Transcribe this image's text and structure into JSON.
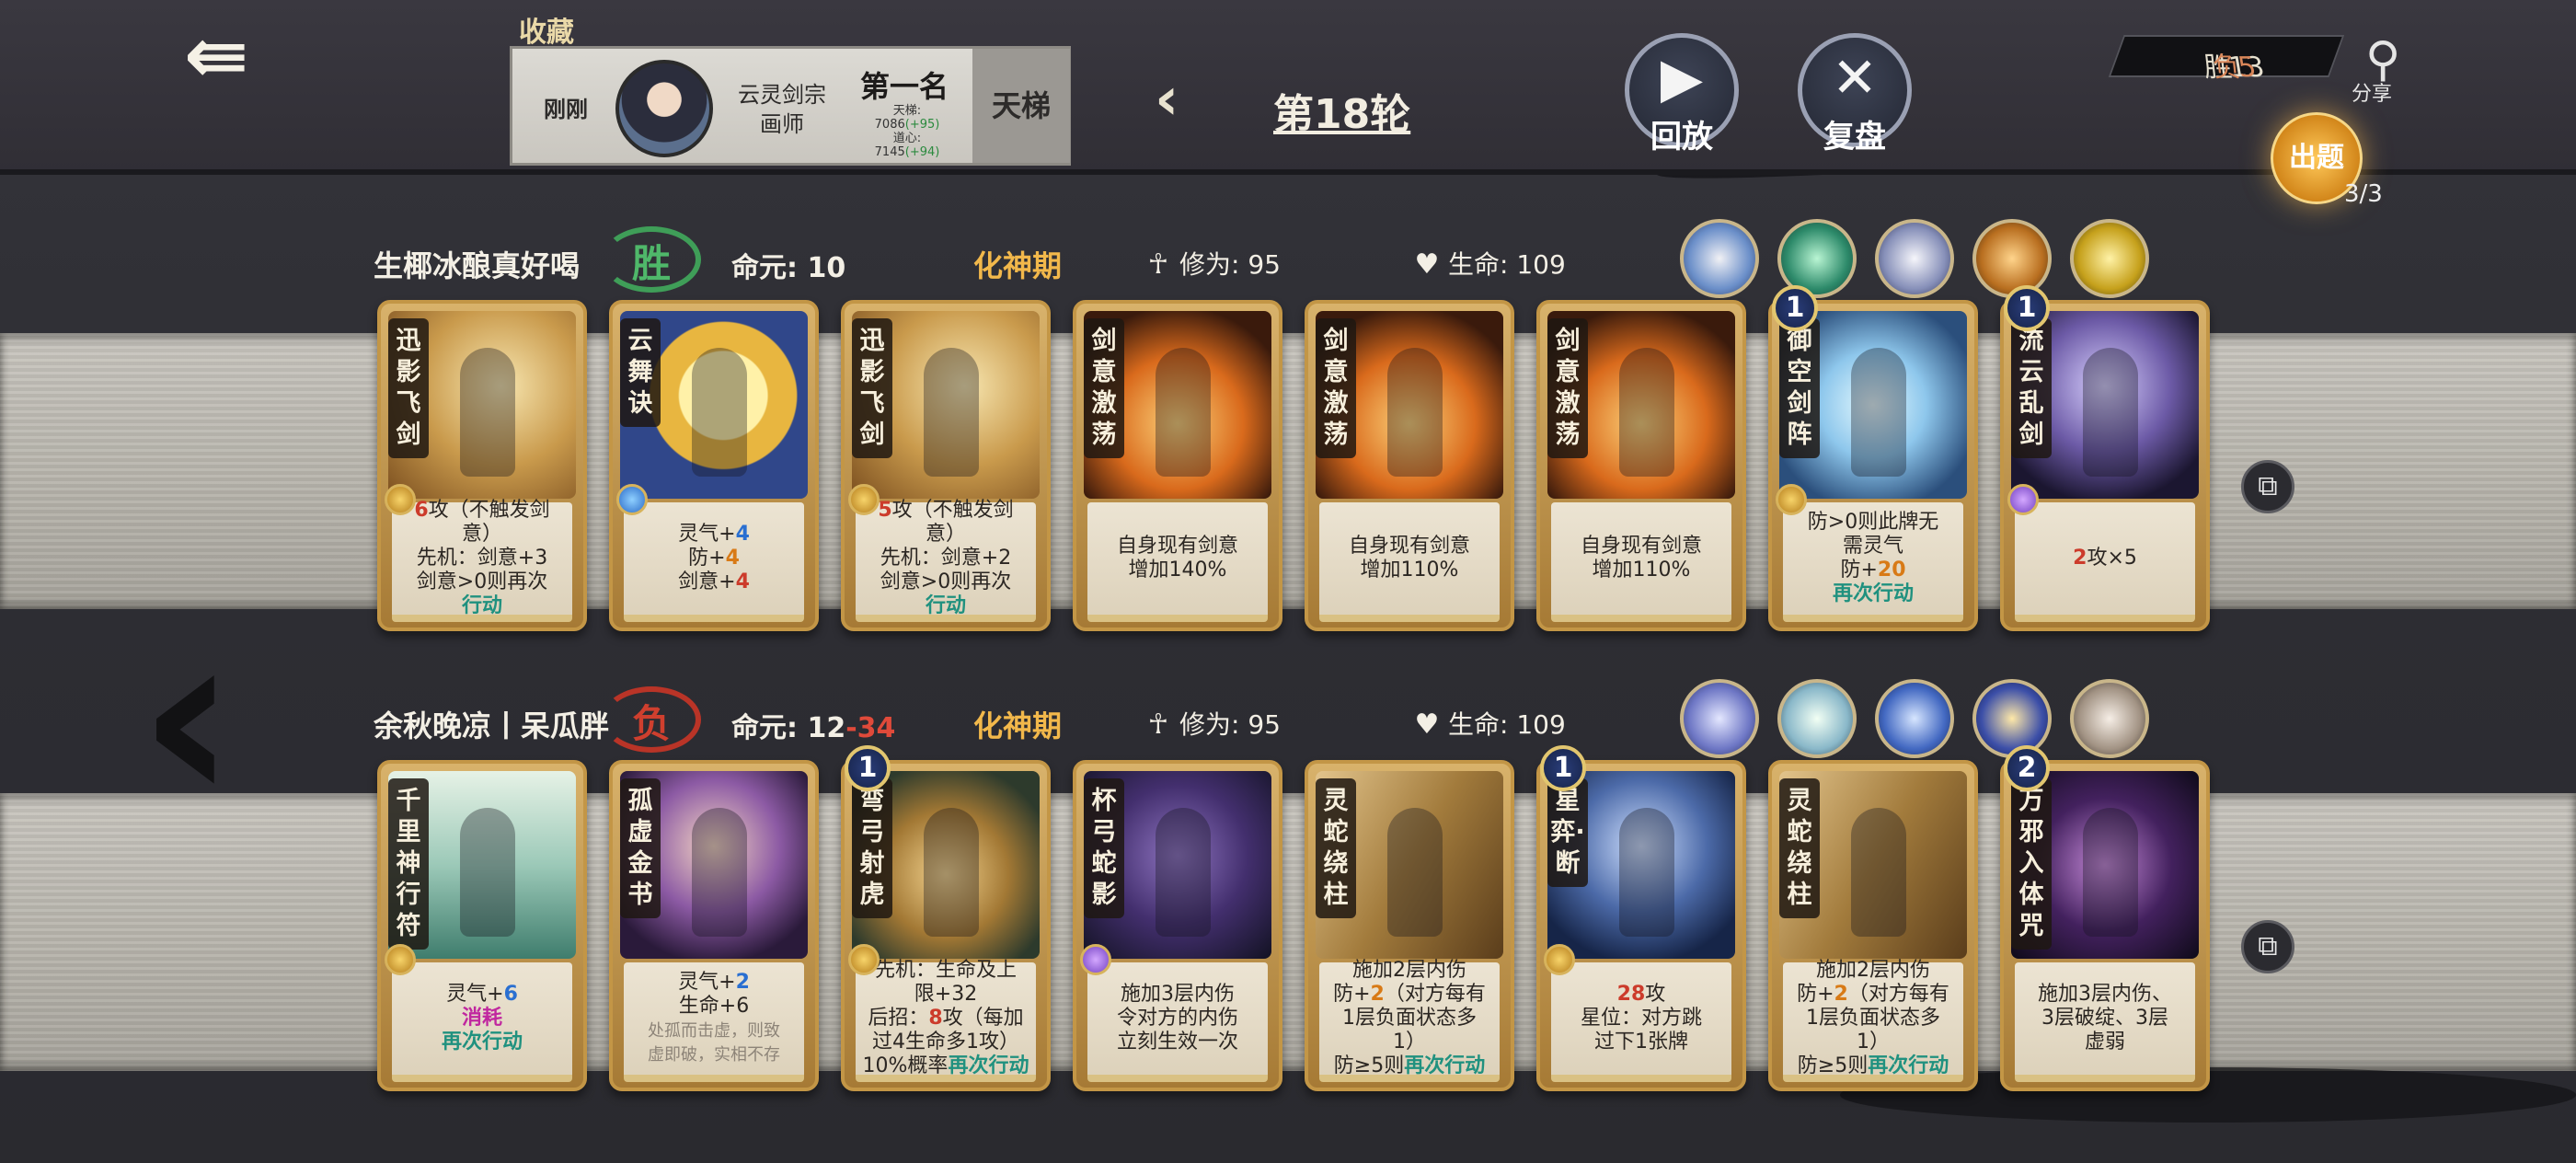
{
  "collect_label": "收藏",
  "opponent_panel": {
    "time": "刚刚",
    "sect": "云灵剑宗",
    "title": "画师",
    "rank": "第一名",
    "stat1_label": "天梯:",
    "stat1_value": "7086",
    "stat1_delta": "(+95)",
    "stat2_label": "道心:",
    "stat2_value": "7145",
    "stat2_delta": "(+94)",
    "ladder": "天梯"
  },
  "round": "第18轮",
  "buttons": {
    "replay": "回放",
    "review": "复盘"
  },
  "record": {
    "win": "胜13",
    "lose": "负5"
  },
  "share": "分享",
  "puzzle": {
    "label": "出题",
    "count": "3/3"
  },
  "players": [
    {
      "name": "生椰冰酿真好喝",
      "result": "胜",
      "life_label": "命元:",
      "life": "10",
      "life_loss": "",
      "realm": "化神期",
      "cultivation_label": "修为:",
      "cultivation": "95",
      "hp_label": "生命:",
      "hp": "109",
      "cards": [
        {
          "name": "迅影飞剑",
          "level": "",
          "orb": "gold",
          "art": "a-gold",
          "lines": [
            [
              [
                "6",
                "t-red"
              ],
              [
                "攻（不触发剑",
                ""
              ]
            ],
            [
              [
                "意）",
                ""
              ]
            ],
            [
              [
                "先机：剑意+3",
                ""
              ]
            ],
            [
              [
                "剑意>0则",
                ""
              ],
              [
                "再次",
                ""
              ]
            ],
            [
              [
                "行动",
                "t-teal"
              ]
            ]
          ]
        },
        {
          "name": "云舞诀",
          "level": "",
          "orb": "blue",
          "art": "a-yellow",
          "lines": [
            [
              [
                "灵气+",
                ""
              ],
              [
                "4",
                "t-blu"
              ]
            ],
            [
              [
                "防+",
                ""
              ],
              [
                "4",
                "t-org"
              ]
            ],
            [
              [
                "剑意+",
                ""
              ],
              [
                "4",
                "t-red"
              ]
            ]
          ]
        },
        {
          "name": "迅影飞剑",
          "level": "",
          "orb": "gold",
          "art": "a-gold",
          "lines": [
            [
              [
                "5",
                "t-red"
              ],
              [
                "攻（不触发剑",
                ""
              ]
            ],
            [
              [
                "意）",
                ""
              ]
            ],
            [
              [
                "先机：剑意+2",
                ""
              ]
            ],
            [
              [
                "剑意>0则",
                ""
              ],
              [
                "再次",
                ""
              ]
            ],
            [
              [
                "行动",
                "t-teal"
              ]
            ]
          ]
        },
        {
          "name": "剑意激荡",
          "level": "",
          "orb": "",
          "art": "a-fire",
          "lines": [
            [
              [
                "自身现有剑意",
                ""
              ]
            ],
            [
              [
                "增加140%",
                ""
              ]
            ]
          ]
        },
        {
          "name": "剑意激荡",
          "level": "",
          "orb": "",
          "art": "a-fire",
          "lines": [
            [
              [
                "自身现有剑意",
                ""
              ]
            ],
            [
              [
                "增加110%",
                ""
              ]
            ]
          ]
        },
        {
          "name": "剑意激荡",
          "level": "",
          "orb": "",
          "art": "a-fire",
          "lines": [
            [
              [
                "自身现有剑意",
                ""
              ]
            ],
            [
              [
                "增加110%",
                ""
              ]
            ]
          ]
        },
        {
          "name": "御空剑阵",
          "level": "1",
          "orb": "gold",
          "art": "a-ice",
          "lines": [
            [
              [
                "防>0则此牌无",
                ""
              ]
            ],
            [
              [
                "需灵气",
                ""
              ]
            ],
            [
              [
                "防+",
                ""
              ],
              [
                "20",
                "t-org"
              ]
            ],
            [
              [
                "再次行动",
                "t-teal"
              ]
            ]
          ]
        },
        {
          "name": "流云乱剑",
          "level": "1",
          "orb": "purple",
          "art": "a-void",
          "lines": [
            [
              [
                "2",
                "t-red"
              ],
              [
                "攻×5",
                ""
              ]
            ]
          ]
        }
      ]
    },
    {
      "name": "余秋晚凉丨呆瓜胖",
      "result": "负",
      "life_label": "命元:",
      "life": "12",
      "life_loss": "-34",
      "realm": "化神期",
      "cultivation_label": "修为:",
      "cultivation": "95",
      "hp_label": "生命:",
      "hp": "109",
      "cards": [
        {
          "name": "千里神行符",
          "level": "",
          "orb": "gold",
          "art": "a-mount",
          "lines": [
            [
              [
                "灵气+",
                ""
              ],
              [
                "6",
                "t-blu"
              ]
            ],
            [
              [
                "消耗",
                "t-mag"
              ]
            ],
            [
              [
                "再次行动",
                "t-teal"
              ]
            ]
          ]
        },
        {
          "name": "孤虚金书",
          "level": "",
          "orb": "",
          "art": "a-purple",
          "lines": [
            [
              [
                "灵气+",
                ""
              ],
              [
                "2",
                "t-blu"
              ]
            ],
            [
              [
                "生命+6",
                ""
              ]
            ],
            [
              [
                "处孤而击虚，则致",
                "t-grey"
              ]
            ],
            [
              [
                "虚即破，实相不存",
                "t-grey"
              ]
            ]
          ]
        },
        {
          "name": "弯弓射虎",
          "level": "1",
          "orb": "gold",
          "art": "a-tiger",
          "lines": [
            [
              [
                "先机：生命及上",
                ""
              ]
            ],
            [
              [
                "限+32",
                ""
              ]
            ],
            [
              [
                "后招：",
                ""
              ],
              [
                "8",
                "t-red"
              ],
              [
                "攻（每加",
                ""
              ]
            ],
            [
              [
                "过4生命多1攻）",
                ""
              ]
            ],
            [
              [
                "10%概率",
                ""
              ],
              [
                "再次行动",
                "t-teal"
              ]
            ]
          ]
        },
        {
          "name": "杯弓蛇影",
          "level": "",
          "orb": "purple",
          "art": "a-snake",
          "lines": [
            [
              [
                "施加3层内伤",
                ""
              ]
            ],
            [
              [
                "令对方的内伤",
                ""
              ]
            ],
            [
              [
                "立刻生效一次",
                ""
              ]
            ]
          ]
        },
        {
          "name": "灵蛇绕柱",
          "level": "",
          "orb": "",
          "art": "a-pillar",
          "lines": [
            [
              [
                "施加2层内伤",
                ""
              ]
            ],
            [
              [
                "防+",
                ""
              ],
              [
                "2",
                "t-org"
              ],
              [
                "（对方每有",
                ""
              ]
            ],
            [
              [
                "1层负面状态多",
                ""
              ]
            ],
            [
              [
                "1）",
                ""
              ]
            ],
            [
              [
                "防≥5则",
                ""
              ],
              [
                "再次行动",
                "t-teal"
              ]
            ]
          ]
        },
        {
          "name": "星弈·断",
          "level": "1",
          "orb": "gold",
          "art": "a-go",
          "lines": [
            [
              [
                "28",
                "t-red"
              ],
              [
                "攻",
                ""
              ]
            ],
            [
              [
                "星位：对方跳",
                ""
              ]
            ],
            [
              [
                "过下1张牌",
                ""
              ]
            ]
          ]
        },
        {
          "name": "灵蛇绕柱",
          "level": "",
          "orb": "",
          "art": "a-pillar",
          "lines": [
            [
              [
                "施加2层内伤",
                ""
              ]
            ],
            [
              [
                "防+",
                ""
              ],
              [
                "2",
                "t-org"
              ],
              [
                "（对方每有",
                ""
              ]
            ],
            [
              [
                "1层负面状态多",
                ""
              ]
            ],
            [
              [
                "1）",
                ""
              ]
            ],
            [
              [
                "防≥5则",
                ""
              ],
              [
                "再次行动",
                "t-teal"
              ]
            ]
          ]
        },
        {
          "name": "万邪入体咒",
          "level": "2",
          "orb": "",
          "art": "a-curse",
          "lines": [
            [
              [
                "施加3层内伤、",
                ""
              ]
            ],
            [
              [
                "3层破绽、3层",
                ""
              ]
            ],
            [
              [
                "虚弱",
                ""
              ]
            ]
          ]
        }
      ]
    }
  ],
  "icons": {
    "back": "back-arrow-icon",
    "prev_round": "chevron-left-icon",
    "replay": "play-icon",
    "review": "crossed-swords-icon",
    "share": "share-icon",
    "cultivation": "meditation-icon",
    "hp": "heart-icon",
    "copy": "copy-icon",
    "nav_left": "chevron-left-large-icon"
  },
  "colors": {
    "accent_gold": "#f2b84b",
    "win_green": "#4fb86a",
    "lose_red": "#cf3f2e",
    "life_loss": "#e04a3a"
  }
}
